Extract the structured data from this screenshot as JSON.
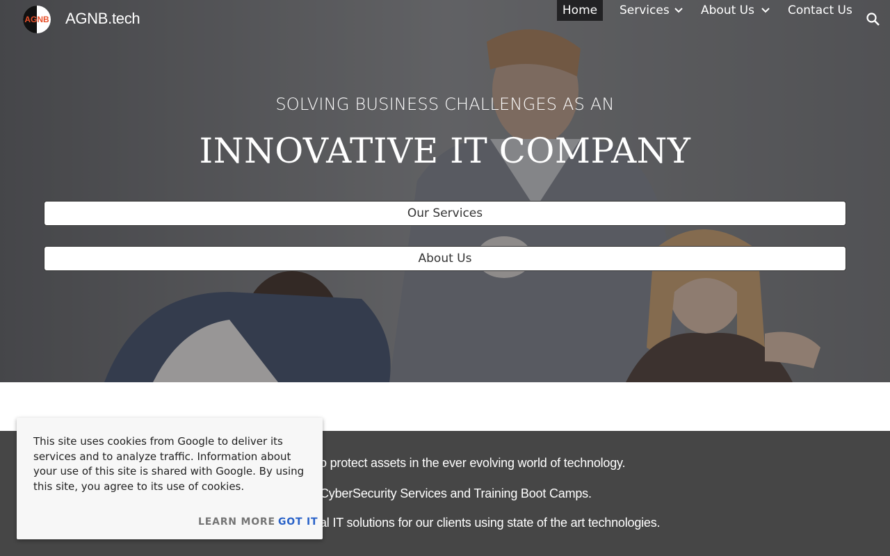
{
  "site": {
    "logo_text": "AGNB",
    "title": "AGNB.tech"
  },
  "nav": {
    "items": [
      {
        "label": "Home",
        "active": true
      },
      {
        "label": "Services",
        "has_dropdown": true
      },
      {
        "label": "About Us",
        "has_dropdown": true
      },
      {
        "label": "Contact Us"
      }
    ],
    "search_icon": "search-icon"
  },
  "hero": {
    "kicker": "SOLVING BUSINESS CHALLENGES AS AN",
    "heading": "INNOVATIVE IT COMPANY",
    "buttons": [
      {
        "label": "Our Services"
      },
      {
        "label": "About Us"
      }
    ]
  },
  "mission": {
    "lines": [
      "o protect assets in the ever evolving world of technology.",
      "CyberSecurity Services and Training Boot Camps.",
      "al IT solutions for our clients using state of the art technologies."
    ]
  },
  "cookie_banner": {
    "message": "This site uses cookies from Google to deliver its services and to analyze traffic. Information about your use of this site is shared with Google. By using this site, you agree to its use of cookies.",
    "learn_more": "LEARN MORE",
    "got_it": "GOT IT"
  },
  "colors": {
    "nav_active_bg": "#222224",
    "dark_section_bg": "#464646",
    "got_it": "#2962c8",
    "logo_accent": "#e8502a"
  }
}
